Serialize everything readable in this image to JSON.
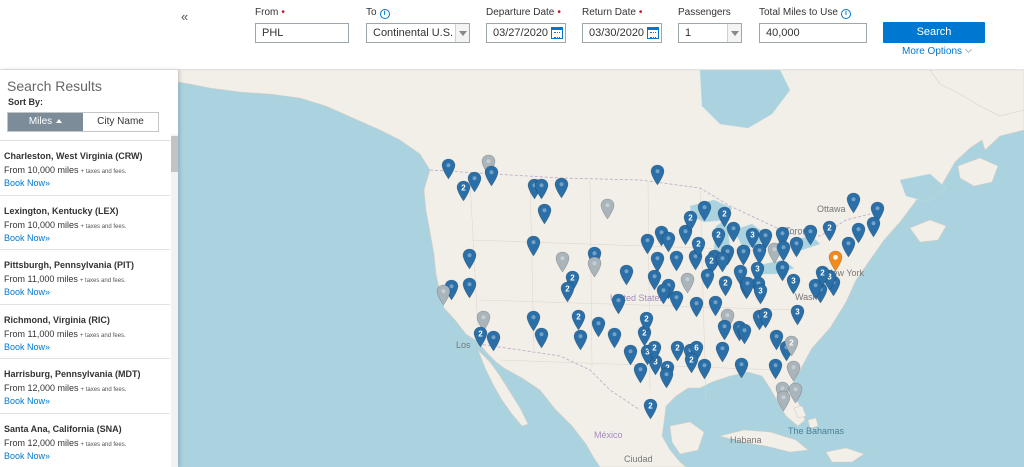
{
  "search": {
    "from": {
      "label": "From",
      "value": "PHL"
    },
    "to": {
      "label": "To",
      "value": "Continental U.S."
    },
    "departure": {
      "label": "Departure Date",
      "value": "03/27/2020"
    },
    "return": {
      "label": "Return Date",
      "value": "03/30/2020"
    },
    "passengers": {
      "label": "Passengers",
      "value": "1"
    },
    "miles": {
      "label": "Total Miles to Use",
      "value": "40,000"
    },
    "required_mark": "•",
    "info_glyph": "i",
    "button_label": "Search",
    "more_options": "More Options"
  },
  "sidebar": {
    "title": "Search Results",
    "collapse_glyph": "«",
    "sort_by_label": "Sort By:",
    "sort_options": [
      "Miles",
      "City Name"
    ],
    "active_sort": "Miles",
    "results": [
      {
        "city": "Charleston, West Virginia (CRW)",
        "price": "From 10,000 miles",
        "fees": "+ taxes and fees.",
        "book": "Book Now»"
      },
      {
        "city": "Lexington, Kentucky (LEX)",
        "price": "From 10,000 miles",
        "fees": "+ taxes and fees.",
        "book": "Book Now»"
      },
      {
        "city": "Pittsburgh, Pennsylvania (PIT)",
        "price": "From 11,000 miles",
        "fees": "+ taxes and fees.",
        "book": "Book Now»"
      },
      {
        "city": "Richmond, Virginia (RIC)",
        "price": "From 11,000 miles",
        "fees": "+ taxes and fees.",
        "book": "Book Now»"
      },
      {
        "city": "Harrisburg, Pennsylvania (MDT)",
        "price": "From 12,000 miles",
        "fees": "+ taxes and fees.",
        "book": "Book Now»"
      },
      {
        "city": "Santa Ana, California (SNA)",
        "price": "From 12,000 miles",
        "fees": "+ taxes and fees.",
        "book": "Book Now»"
      }
    ]
  },
  "map": {
    "labels": {
      "ottawa": "Ottawa",
      "toronto": "Toronto",
      "new_york": "New York",
      "united_states": "United States",
      "washington": "Wash",
      "los_angeles": "Los",
      "mexico": "México",
      "havana": "Habana",
      "bahamas": "The Bahamas",
      "ciudad": "Ciudad"
    },
    "colors": {
      "water": "#aad3df",
      "land": "#f2efe9",
      "pin_available": "#2a6fa8",
      "pin_unavailable": "#a9b4bb",
      "pin_origin": "#f28a1e"
    },
    "cluster_badges": [
      "2",
      "2",
      "2",
      "2",
      "2",
      "3",
      "2",
      "2",
      "2",
      "3",
      "2",
      "2",
      "2",
      "2",
      "2",
      "3",
      "3",
      "2",
      "2",
      "6",
      "2",
      "2",
      "3",
      "3",
      "2",
      "3",
      "3",
      "2",
      "2",
      "2",
      "2",
      "2"
    ]
  }
}
